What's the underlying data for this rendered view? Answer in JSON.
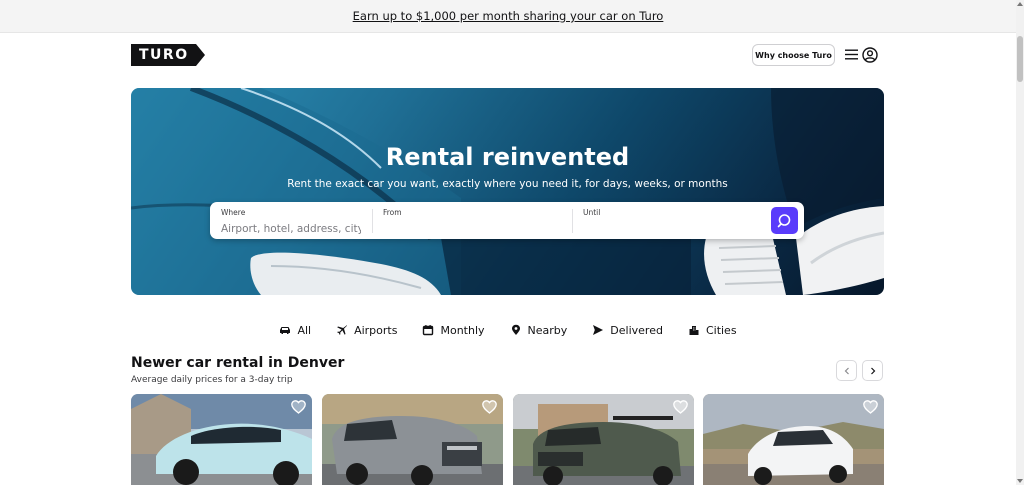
{
  "banner": {
    "text": "Earn up to $1,000 per month sharing your car on Turo"
  },
  "header": {
    "logo_text": "TURO",
    "why_button": "Why choose Turo",
    "menu_icon": "hamburger-menu-icon",
    "account_icon": "account-circle-icon"
  },
  "hero": {
    "title": "Rental reinvented",
    "subtitle": "Rent the exact car you want, exactly where you need it, for days, weeks, or months"
  },
  "search": {
    "where_label": "Where",
    "where_placeholder": "Airport, hotel, address, city",
    "from_label": "From",
    "until_label": "Until",
    "button_icon": "search-icon",
    "accent_color": "#593cfb"
  },
  "categories": [
    {
      "label": "All",
      "icon": "car-icon"
    },
    {
      "label": "Airports",
      "icon": "airplane-icon"
    },
    {
      "label": "Monthly",
      "icon": "calendar-icon"
    },
    {
      "label": "Nearby",
      "icon": "location-pin-icon"
    },
    {
      "label": "Delivered",
      "icon": "paper-plane-icon"
    },
    {
      "label": "Cities",
      "icon": "city-buildings-icon"
    }
  ],
  "section": {
    "title": "Newer car rental in Denver",
    "subtitle": "Average daily prices for a 3-day trip"
  },
  "cards": [
    {
      "name": "light blue SUV parked on driveway",
      "favorite_icon": "heart-icon"
    },
    {
      "name": "gray full-size SUV in parking lot",
      "favorite_icon": "heart-icon"
    },
    {
      "name": "dark green SUV with roof rack",
      "favorite_icon": "heart-icon"
    },
    {
      "name": "white electric SUV near hills",
      "favorite_icon": "heart-icon"
    }
  ]
}
